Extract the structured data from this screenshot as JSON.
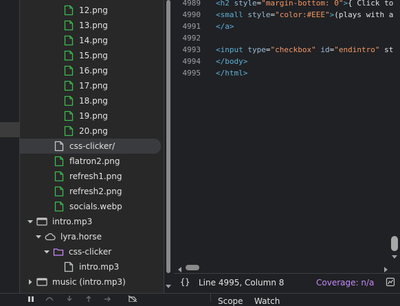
{
  "tree": {
    "items": [
      {
        "label": "12.png",
        "type": "image",
        "depth": 4
      },
      {
        "label": "13.png",
        "type": "image",
        "depth": 4
      },
      {
        "label": "14.png",
        "type": "image",
        "depth": 4
      },
      {
        "label": "15.png",
        "type": "image",
        "depth": 4
      },
      {
        "label": "16.png",
        "type": "image",
        "depth": 4
      },
      {
        "label": "17.png",
        "type": "image",
        "depth": 4
      },
      {
        "label": "18.png",
        "type": "image",
        "depth": 4
      },
      {
        "label": "19.png",
        "type": "image",
        "depth": 4
      },
      {
        "label": "20.png",
        "type": "image",
        "depth": 4
      },
      {
        "label": "css-clicker/",
        "type": "document",
        "depth": 3,
        "selected": true
      },
      {
        "label": "flatron2.png",
        "type": "image",
        "depth": 3
      },
      {
        "label": "refresh1.png",
        "type": "image",
        "depth": 3
      },
      {
        "label": "refresh2.png",
        "type": "image",
        "depth": 3
      },
      {
        "label": "socials.webp",
        "type": "image",
        "depth": 3
      },
      {
        "label": "intro.mp3",
        "type": "frame",
        "depth": 1,
        "expanded": true
      },
      {
        "label": "lyra.horse",
        "type": "cloud",
        "depth": 2,
        "expanded": true
      },
      {
        "label": "css-clicker",
        "type": "folder",
        "depth": 3,
        "expanded": true
      },
      {
        "label": "intro.mp3",
        "type": "document",
        "depth": 4
      },
      {
        "label": "music (intro.mp3)",
        "type": "frame",
        "depth": 1,
        "expanded": false
      }
    ]
  },
  "editor": {
    "lines": [
      {
        "num": "4989",
        "tokens": [
          [
            "tg",
            "<h2 "
          ],
          [
            "at",
            "style"
          ],
          [
            "tx",
            "="
          ],
          [
            "st",
            "\"margin-bottom: 0\""
          ],
          [
            "tg",
            ">"
          ],
          [
            "tx",
            "{ Click to"
          ]
        ]
      },
      {
        "num": "4990",
        "tokens": [
          [
            "tg",
            "<small "
          ],
          [
            "at",
            "style"
          ],
          [
            "tx",
            "="
          ],
          [
            "st",
            "\"color:#EEE\""
          ],
          [
            "tg",
            ">"
          ],
          [
            "tx",
            "(plays with a"
          ]
        ]
      },
      {
        "num": "4991",
        "tokens": [
          [
            "tg",
            "</a>"
          ]
        ]
      },
      {
        "num": "4992",
        "tokens": []
      },
      {
        "num": "4993",
        "tokens": [
          [
            "tg",
            "<input "
          ],
          [
            "at",
            "type"
          ],
          [
            "tx",
            "="
          ],
          [
            "st",
            "\"checkbox\""
          ],
          [
            "tx",
            " "
          ],
          [
            "at",
            "id"
          ],
          [
            "tx",
            "="
          ],
          [
            "st",
            "\"endintro\""
          ],
          [
            "tx",
            " st"
          ]
        ]
      },
      {
        "num": "4994",
        "tokens": [
          [
            "tg",
            "</body>"
          ]
        ]
      },
      {
        "num": "4995",
        "tokens": [
          [
            "tg",
            "</html>"
          ]
        ]
      }
    ]
  },
  "status": {
    "braces": "{}",
    "position": "Line 4995, Column 8",
    "coverage": "Coverage: n/a"
  },
  "bottom_tabs": {
    "scope": "Scope",
    "watch": "Watch"
  },
  "colors": {
    "image_icon": "#3fb950",
    "folder_icon": "#c58af9",
    "accent_purple": "#c58af9"
  }
}
